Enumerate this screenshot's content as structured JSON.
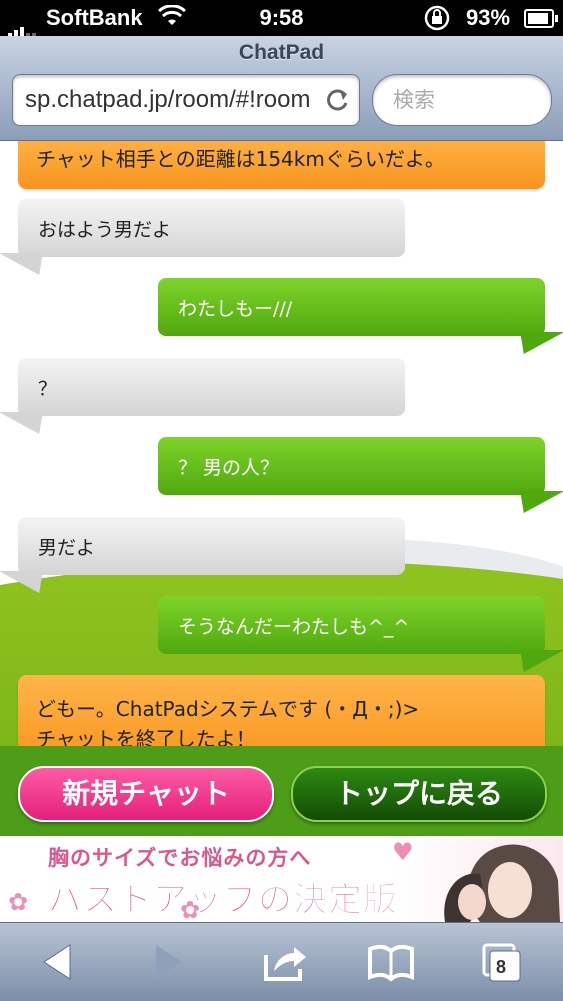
{
  "status_bar": {
    "carrier": "SoftBank",
    "time": "9:58",
    "battery": "93%"
  },
  "browser": {
    "title": "ChatPad",
    "url": "sp.chatpad.jp/room/#!room",
    "search_placeholder": "検索",
    "tab_count": "8"
  },
  "chat": {
    "system_top": "チャット相手との距離は154kmぐらいだよ。",
    "messages": [
      {
        "side": "left",
        "text": "おはよう男だよ"
      },
      {
        "side": "right",
        "text": "わたしもー///"
      },
      {
        "side": "left",
        "text": "？"
      },
      {
        "side": "right",
        "text": "？ 男の人？"
      },
      {
        "side": "left",
        "text": "男だよ"
      },
      {
        "side": "right",
        "text": "そうなんだーわたしも^_^"
      }
    ],
    "system_end_line1": "どもー。ChatPadシステムです (・Д・;)>",
    "system_end_line2": "チャットを終了したよ！"
  },
  "actions": {
    "new_chat": "新規チャット",
    "back_top": "トップに戻る"
  },
  "ad": {
    "line1": "胸のサイズでお悩みの方へ",
    "line2": "バストアップの決定版"
  },
  "colors": {
    "orange": "#f7941d",
    "green_bubble": "#4fa80e",
    "gray_bubble": "#d4d4d4",
    "pink_button": "#e4207a",
    "dark_green_button": "#134c05"
  }
}
